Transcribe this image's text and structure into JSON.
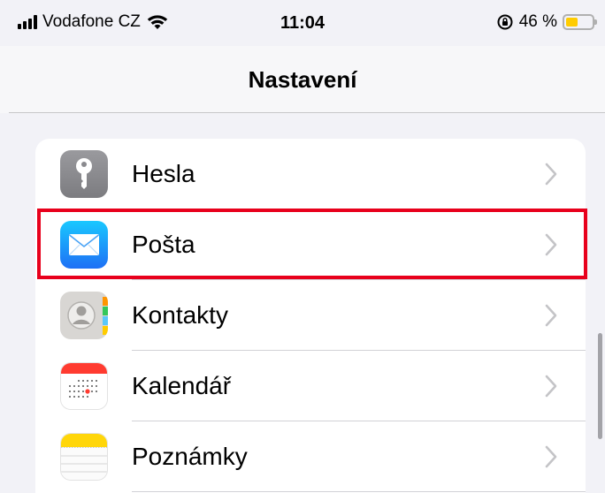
{
  "status_bar": {
    "carrier": "Vodafone CZ",
    "time": "11:04",
    "battery_percent_label": "46 %",
    "battery_level": 0.46,
    "icons": [
      "signal-icon",
      "wifi-icon",
      "rotation-lock-icon",
      "battery-icon"
    ]
  },
  "navbar": {
    "title": "Nastavení"
  },
  "settings_rows": [
    {
      "label": "Hesla",
      "icon": "key-icon"
    },
    {
      "label": "Pošta",
      "icon": "mail-icon",
      "highlighted": true
    },
    {
      "label": "Kontakty",
      "icon": "contacts-icon"
    },
    {
      "label": "Kalendář",
      "icon": "calendar-icon"
    },
    {
      "label": "Poznámky",
      "icon": "notes-icon"
    }
  ],
  "colors": {
    "highlight": "#e8001c",
    "battery_fill": "#ffcc00",
    "mail_blue": "#1e90ff",
    "calendar_red": "#ff3b30",
    "notes_yellow": "#ffd60a"
  }
}
